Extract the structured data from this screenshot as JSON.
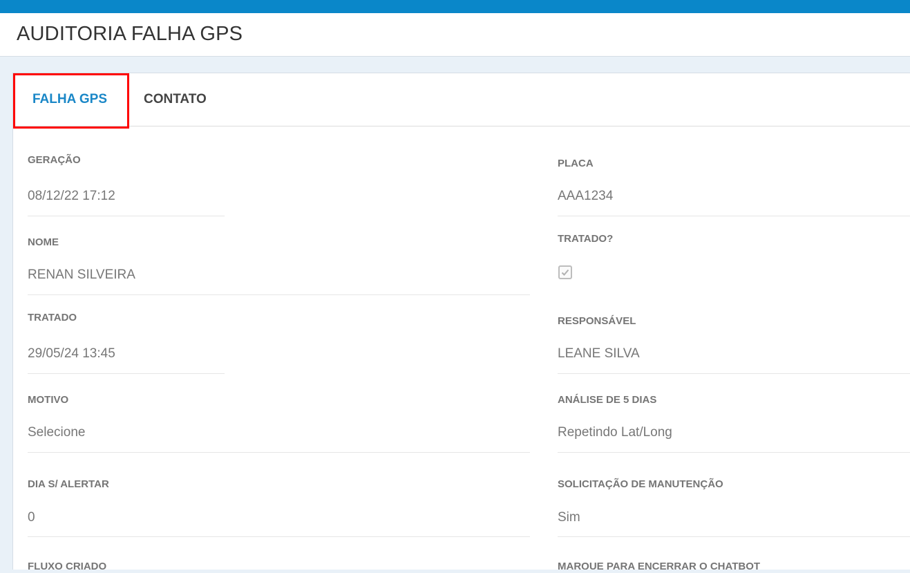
{
  "page": {
    "title": "AUDITORIA FALHA GPS"
  },
  "tabs": [
    {
      "label": "FALHA GPS",
      "active": true
    },
    {
      "label": "CONTATO",
      "active": false
    }
  ],
  "colors": {
    "topbar": "#0a87c9",
    "active_tab": "#1a87c7",
    "highlight_box": "#ff0000"
  },
  "left_fields": [
    {
      "label": "GERAÇÃO",
      "value": "08/12/22 17:12"
    },
    {
      "label": "NOME",
      "value": "RENAN SILVEIRA"
    },
    {
      "label": "TRATADO",
      "value": "29/05/24 13:45"
    },
    {
      "label": "MOTIVO",
      "value": "Selecione"
    },
    {
      "label": "DIA S/ ALERTAR",
      "value": "0"
    },
    {
      "label": "FLUXO CRIADO"
    }
  ],
  "right_fields": [
    {
      "label": "PLACA",
      "value": "AAA1234"
    },
    {
      "label": "TRATADO?",
      "checked": true,
      "icon": "checkbox-checked-icon"
    },
    {
      "label": "RESPONSÁVEL",
      "value": "LEANE SILVA"
    },
    {
      "label": "ANÁLISE DE 5 DIAS",
      "value": "Repetindo Lat/Long"
    },
    {
      "label": "SOLICITAÇÃO DE MANUTENÇÃO",
      "value": "Sim"
    },
    {
      "label": "MARQUE PARA ENCERRAR O CHATBOT"
    }
  ]
}
